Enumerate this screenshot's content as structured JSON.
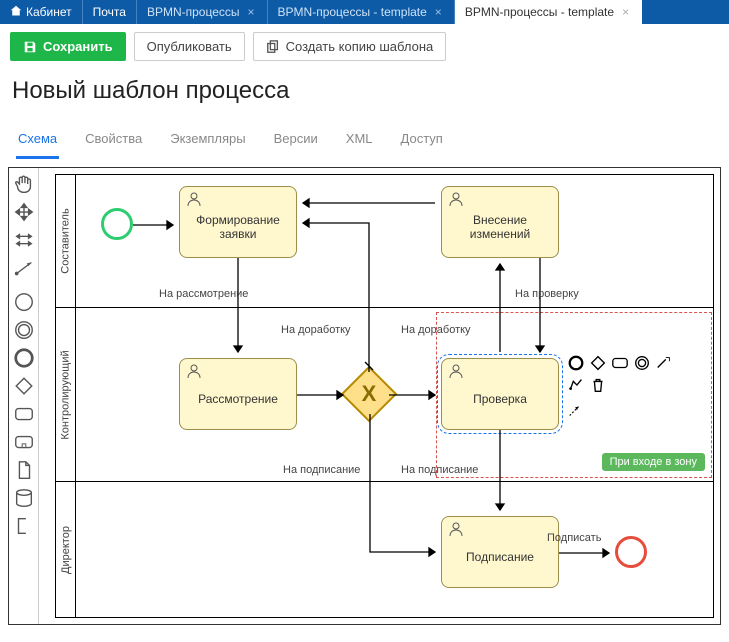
{
  "topnav": {
    "cabinet": "Кабинет",
    "mail": "Почта"
  },
  "tabs": [
    {
      "label": "BPMN-процессы",
      "active": false
    },
    {
      "label": "BPMN-процессы - template",
      "active": false
    },
    {
      "label": "BPMN-процессы - template",
      "active": true
    }
  ],
  "toolbar": {
    "save": "Сохранить",
    "publish": "Опубликовать",
    "copy": "Создать копию шаблона"
  },
  "title": "Новый шаблон процесса",
  "subtabs": {
    "scheme": "Схема",
    "properties": "Свойства",
    "instances": "Экземпляры",
    "versions": "Версии",
    "xml": "XML",
    "access": "Доступ"
  },
  "lanes": {
    "composer": "Составитель",
    "controller": "Контролирующий",
    "director": "Директор"
  },
  "tasks": {
    "form_request": "Формирование заявки",
    "amend": "Внесение изменений",
    "review": "Рассмотрение",
    "check": "Проверка",
    "sign": "Подписание"
  },
  "flows": {
    "to_review": "На рассмотрение",
    "to_rework1": "На доработку",
    "to_rework2": "На доработку",
    "to_check": "На проверку",
    "to_sign1": "На подписание",
    "to_sign2": "На подписание",
    "sign_action": "Подписать"
  },
  "zone_badge": "При входе в зону",
  "palette_icons": [
    "hand",
    "lasso",
    "space",
    "connect-global",
    "start-circle",
    "intermediate-circle",
    "end-circle",
    "gateway-diamond",
    "task-rect",
    "subprocess-rect",
    "data-object",
    "data-store",
    "text-annotation"
  ],
  "context_icons": [
    "circle-bold",
    "diamond",
    "rect-round",
    "double-circle",
    "connect-arrow",
    "wrench",
    "trash",
    "arrows-out"
  ]
}
